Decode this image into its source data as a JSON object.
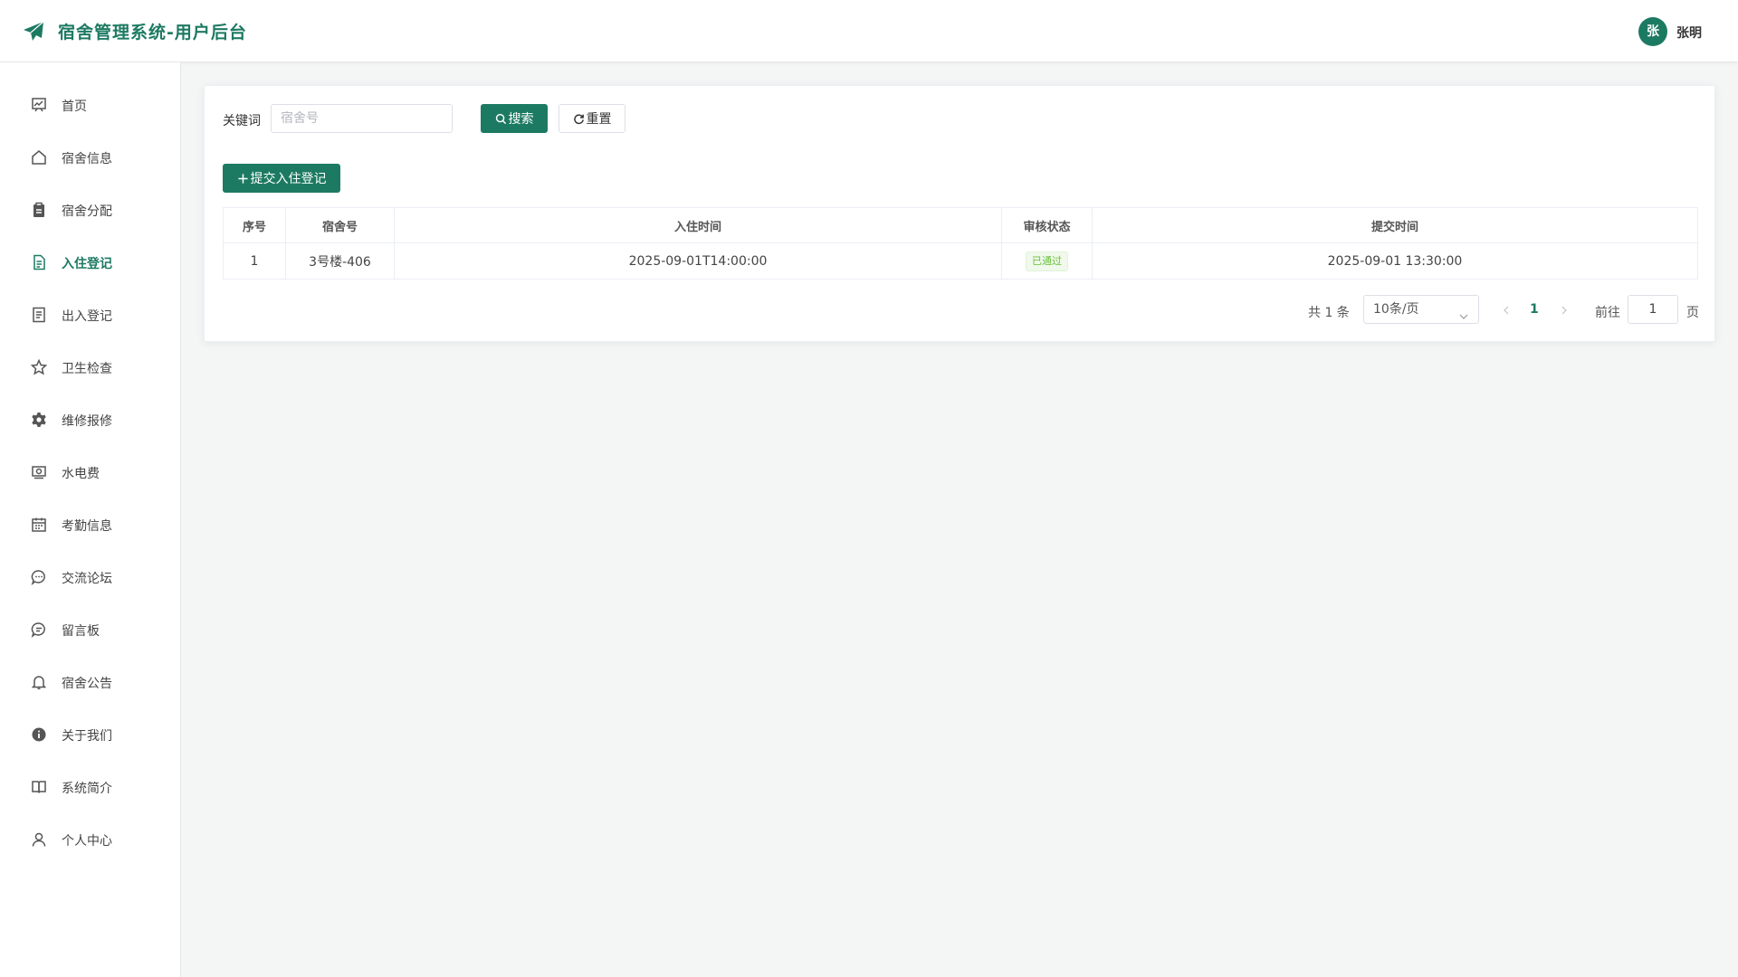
{
  "header": {
    "app_title": "宿舍管理系统-用户后台",
    "avatar_text": "张",
    "username": "张明",
    "brand_color": "#1d7a62"
  },
  "sidebar": {
    "items": [
      {
        "label": "首页",
        "icon": "chart-board-icon"
      },
      {
        "label": "宿舍信息",
        "icon": "house-icon"
      },
      {
        "label": "宿舍分配",
        "icon": "clipboard-icon"
      },
      {
        "label": "入住登记",
        "icon": "document-icon",
        "active": true
      },
      {
        "label": "出入登记",
        "icon": "tickets-icon"
      },
      {
        "label": "卫生检查",
        "icon": "star-icon"
      },
      {
        "label": "维修报修",
        "icon": "gear-icon"
      },
      {
        "label": "水电费",
        "icon": "money-icon"
      },
      {
        "label": "考勤信息",
        "icon": "calendar-icon"
      },
      {
        "label": "交流论坛",
        "icon": "chat-dots-icon"
      },
      {
        "label": "留言板",
        "icon": "chat-lines-icon"
      },
      {
        "label": "宿舍公告",
        "icon": "bell-icon"
      },
      {
        "label": "关于我们",
        "icon": "info-icon"
      },
      {
        "label": "系统简介",
        "icon": "book-icon"
      },
      {
        "label": "个人中心",
        "icon": "user-icon"
      }
    ]
  },
  "search": {
    "label": "关键词",
    "placeholder": "宿舍号",
    "value": "",
    "search_button": "搜索",
    "reset_button": "重置"
  },
  "actions": {
    "add_button": "提交入住登记"
  },
  "table": {
    "headers": [
      "序号",
      "宿舍号",
      "入住时间",
      "审核状态",
      "提交时间"
    ],
    "rows": [
      {
        "index": "1",
        "room": "3号楼-406",
        "checkin_time": "2025-09-01T14:00:00",
        "status": "已通过",
        "submit_time": "2025-09-01 13:30:00"
      }
    ]
  },
  "pagination": {
    "total_text": "共 1 条",
    "page_size": "10条/页",
    "current_page": "1",
    "goto_label": "前往",
    "goto_value": "1",
    "page_suffix": "页"
  }
}
